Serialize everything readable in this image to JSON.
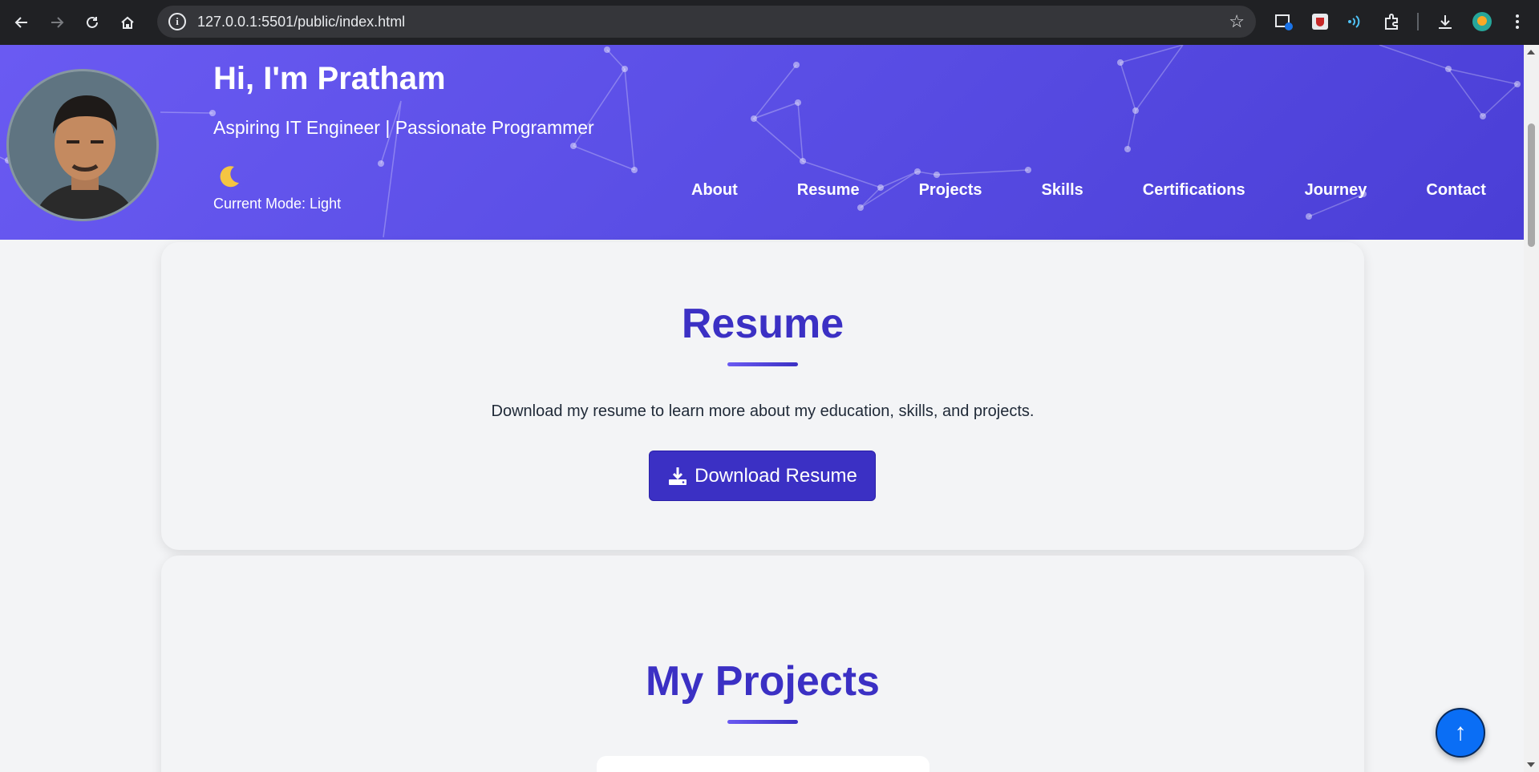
{
  "browser": {
    "url": "127.0.0.1:5501/public/index.html",
    "info_glyph": "i"
  },
  "header": {
    "title": "Hi, I'm Pratham",
    "subtitle": "Aspiring IT Engineer | Passionate Programmer",
    "mode_label": "Current Mode: Light",
    "mode_icon": "moon-icon",
    "nav": [
      "About",
      "Resume",
      "Projects",
      "Skills",
      "Certifications",
      "Journey",
      "Contact"
    ]
  },
  "resume": {
    "title": "Resume",
    "text": "Download my resume to learn more about my education, skills, and projects.",
    "button_label": "Download Resume"
  },
  "projects": {
    "title": "My Projects"
  },
  "scroll_top": {
    "glyph": "↑"
  },
  "colors": {
    "accent": "#3b30c4",
    "header_gradient_start": "#6a5af2",
    "header_gradient_end": "#4a3ed6",
    "scroll_top_button": "#0a6ef5"
  }
}
